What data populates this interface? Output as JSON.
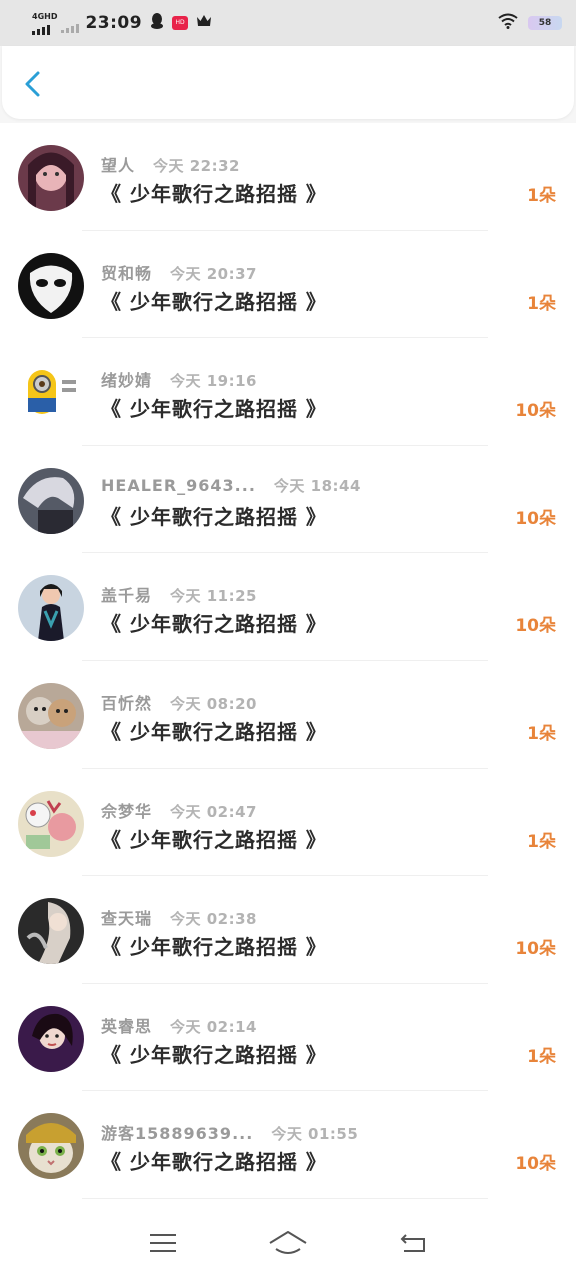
{
  "status_bar": {
    "network": "4GHD",
    "time": "23:09",
    "battery": "58",
    "app_badge": "HD"
  },
  "header": {
    "back_icon": "chevron-left-icon"
  },
  "song_title": "《 少年歌行之路招摇 》",
  "records": [
    {
      "name": "望人",
      "time": "今天 22:32",
      "gift": "1朵",
      "avatar": "a1"
    },
    {
      "name": "贸和畅",
      "time": "今天 20:37",
      "gift": "1朵",
      "avatar": "a2"
    },
    {
      "name": "绪妙婧",
      "time": "今天 19:16",
      "gift": "10朵",
      "avatar": "a3"
    },
    {
      "name": "HEALER_9643...",
      "time": "今天 18:44",
      "gift": "10朵",
      "avatar": "a4"
    },
    {
      "name": "盖千易",
      "time": "今天 11:25",
      "gift": "10朵",
      "avatar": "a5"
    },
    {
      "name": "百忻然",
      "time": "今天 08:20",
      "gift": "1朵",
      "avatar": "a6"
    },
    {
      "name": "佘梦华",
      "time": "今天 02:47",
      "gift": "1朵",
      "avatar": "a7"
    },
    {
      "name": "查天瑞",
      "time": "今天 02:38",
      "gift": "10朵",
      "avatar": "a8"
    },
    {
      "name": "英睿思",
      "time": "今天 02:14",
      "gift": "1朵",
      "avatar": "a9"
    },
    {
      "name": "游客15889639...",
      "time": "今天 01:55",
      "gift": "10朵",
      "avatar": "a10"
    }
  ],
  "navbar": {
    "menu_icon": "menu-icon",
    "home_icon": "home-icon",
    "back_icon": "return-icon"
  },
  "colors": {
    "accent_blue": "#2a9fd6",
    "gift_orange": "#e8843a"
  }
}
